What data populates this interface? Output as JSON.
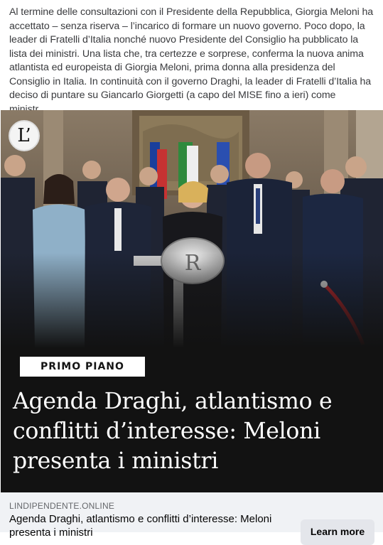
{
  "post": {
    "text": "Al termine delle consultazioni con il Presidente della Repubblica, Giorgia Meloni ha accettato – senza riserva – l’incarico di formare un nuovo governo. Poco dopo, la leader di Fratelli d’Italia nonché nuovo Presidente del Consiglio ha pubblicato la lista dei ministri. Una lista che, tra certezze e sorprese, conferma la nuova anima atlantista ed europeista di Giorgia Meloni, prima donna alla presidenza del Consiglio in Italia. In continuità con il governo Draghi, la leader di Fratelli d’Italia ha deciso di puntare su Giancarlo Giorgetti (a capo del MISE fino a ieri) come ministr…"
  },
  "link_preview": {
    "source_logo": "L’",
    "badge": "PRIMO PIANO",
    "headline": "Agenda Draghi, atlantismo e conflitti d’interesse: Meloni presenta i ministri",
    "domain": "LINDIPENDENTE.ONLINE",
    "title": "Agenda Draghi, atlantismo e conflitti d’interesse: Meloni presenta i ministri",
    "cta_label": "Learn more"
  },
  "colors": {
    "hero_background": "#121212",
    "meta_background": "#f0f2f5",
    "button_background": "#e4e6eb"
  }
}
